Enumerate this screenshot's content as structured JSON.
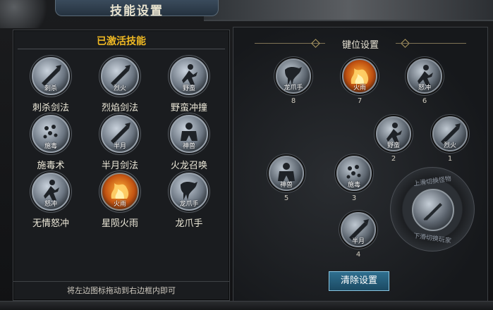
{
  "window": {
    "title": "技能设置"
  },
  "left_panel": {
    "header": "已激活技能",
    "footer_hint": "将左边图标拖动到右边框内即可",
    "skills": [
      {
        "name": "刺杀剑法",
        "icon_label": "刺杀",
        "icon": "sword-thrust-icon",
        "fire": false
      },
      {
        "name": "烈焰剑法",
        "icon_label": "烈火",
        "icon": "flaming-sword-icon",
        "fire": false
      },
      {
        "name": "野蛮冲撞",
        "icon_label": "野蛮",
        "icon": "charge-icon",
        "fire": false
      },
      {
        "name": "施毒术",
        "icon_label": "施毒",
        "icon": "poison-icon",
        "fire": false
      },
      {
        "name": "半月剑法",
        "icon_label": "半月",
        "icon": "crescent-sword-icon",
        "fire": false
      },
      {
        "name": "火龙召唤",
        "icon_label": "神兽",
        "icon": "beast-summon-icon",
        "fire": false
      },
      {
        "name": "无情怒冲",
        "icon_label": "怒冲",
        "icon": "rage-charge-icon",
        "fire": false
      },
      {
        "name": "星陨火雨",
        "icon_label": "火雨",
        "icon": "fire-rain-icon",
        "fire": true
      },
      {
        "name": "龙爪手",
        "icon_label": "龙爪手",
        "icon": "dragon-claw-icon",
        "fire": false
      }
    ]
  },
  "right_panel": {
    "header": "键位设置",
    "slots": [
      {
        "key": "8",
        "icon_label": "龙爪手",
        "icon": "dragon-claw-icon",
        "fire": false
      },
      {
        "key": "7",
        "icon_label": "火雨",
        "icon": "fire-rain-icon",
        "fire": true
      },
      {
        "key": "6",
        "icon_label": "怒冲",
        "icon": "rage-charge-icon",
        "fire": false
      },
      {
        "key": "2",
        "icon_label": "野蛮",
        "icon": "charge-icon",
        "fire": false
      },
      {
        "key": "1",
        "icon_label": "烈火",
        "icon": "flaming-sword-icon",
        "fire": false
      },
      {
        "key": "5",
        "icon_label": "神兽",
        "icon": "beast-summon-icon",
        "fire": false
      },
      {
        "key": "3",
        "icon_label": "施毒",
        "icon": "poison-icon",
        "fire": false
      },
      {
        "key": "4",
        "icon_label": "半月",
        "icon": "crescent-sword-icon",
        "fire": false
      }
    ],
    "switcher": {
      "top_text": "上滑切换怪物",
      "bottom_text": "下滑切换玩家",
      "icon": "sword-switch-icon"
    },
    "clear_button": "清除设置"
  },
  "colors": {
    "accent_gold": "#f0b923",
    "button_blue": "#2f6f8f"
  }
}
